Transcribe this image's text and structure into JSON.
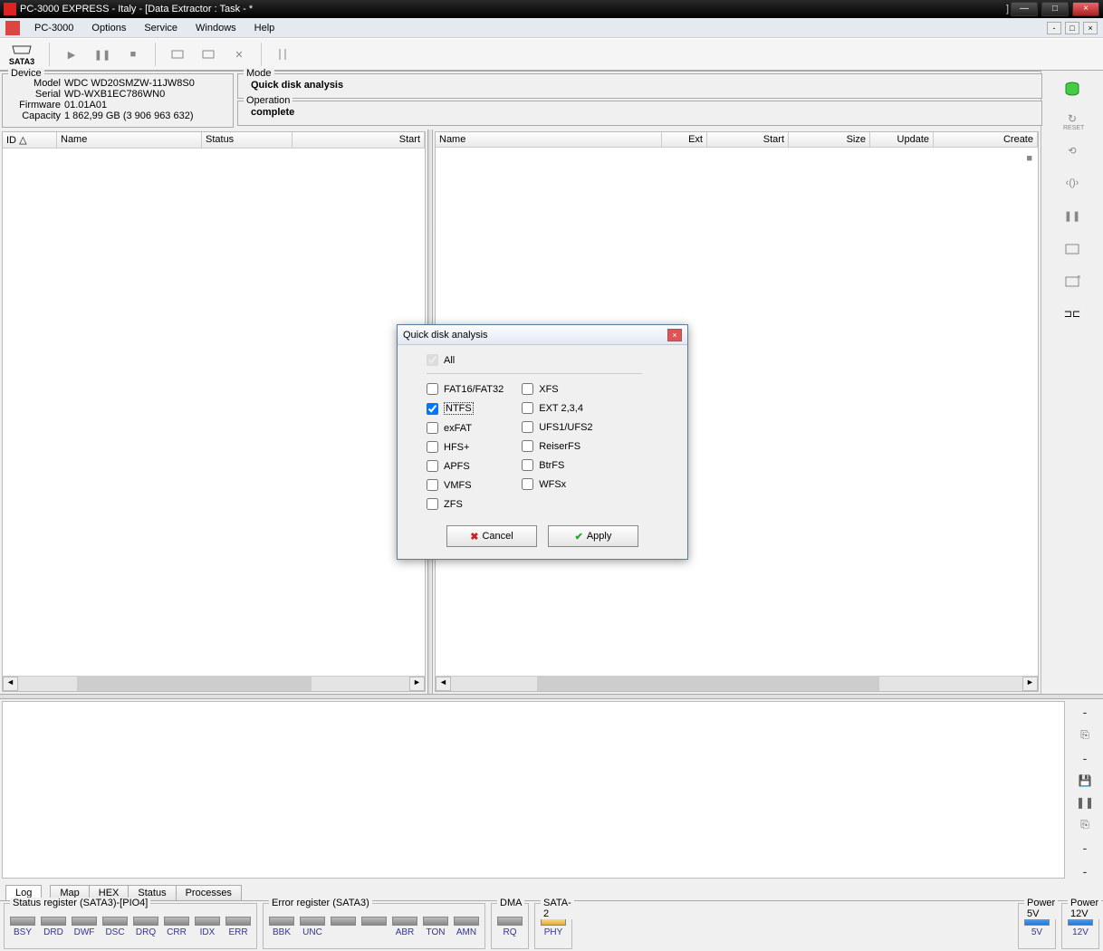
{
  "window": {
    "title": "PC-3000 EXPRESS - Italy - [Data Extractor : Task - *",
    "bracket": "]"
  },
  "menu": {
    "items": [
      "PC-3000",
      "Options",
      "Service",
      "Windows",
      "Help"
    ]
  },
  "toolbar": {
    "port": "SATA3"
  },
  "device": {
    "legend": "Device",
    "model_lbl": "Model",
    "model": "WDC WD20SMZW-11JW8S0",
    "serial_lbl": "Serial",
    "serial": "WD-WXB1EC786WN0",
    "firmware_lbl": "Firmware",
    "firmware": "01.01A01",
    "capacity_lbl": "Capacity",
    "capacity": "1 862,99 GB (3 906 963 632)"
  },
  "mode": {
    "legend": "Mode",
    "value": "Quick disk  analysis"
  },
  "operation": {
    "legend": "Operation",
    "value": "complete"
  },
  "table_left": {
    "cols": [
      "ID",
      "Name",
      "Status",
      "Start"
    ]
  },
  "table_right": {
    "cols": [
      "Name",
      "Ext",
      "Start",
      "Size",
      "Update",
      "Create"
    ]
  },
  "dialog": {
    "title": "Quick disk  analysis",
    "all": "All",
    "left": [
      "FAT16/FAT32",
      "NTFS",
      "exFAT",
      "HFS+",
      "APFS",
      "VMFS",
      "ZFS"
    ],
    "right": [
      "XFS",
      "EXT 2,3,4",
      "UFS1/UFS2",
      "ReiserFS",
      "BtrFS",
      "WFSx"
    ],
    "checked": "NTFS",
    "cancel": "Cancel",
    "apply": "Apply"
  },
  "tabs": {
    "log": "Log",
    "items": [
      "Map",
      "HEX",
      "Status",
      "Processes"
    ]
  },
  "status": {
    "reg1_legend": "Status register (SATA3)-[PIO4]",
    "reg1": [
      "BSY",
      "DRD",
      "DWF",
      "DSC",
      "DRQ",
      "CRR",
      "IDX",
      "ERR"
    ],
    "reg2_legend": "Error register (SATA3)",
    "reg2": [
      "BBK",
      "UNC",
      "",
      "",
      "ABR",
      "TON",
      "AMN"
    ],
    "dma_legend": "DMA",
    "dma": [
      "RQ"
    ],
    "sata2_legend": "SATA-2",
    "sata2": [
      "PHY"
    ],
    "p5_legend": "Power 5V",
    "p5": "5V",
    "p12_legend": "Power 12V",
    "p12": "12V"
  }
}
